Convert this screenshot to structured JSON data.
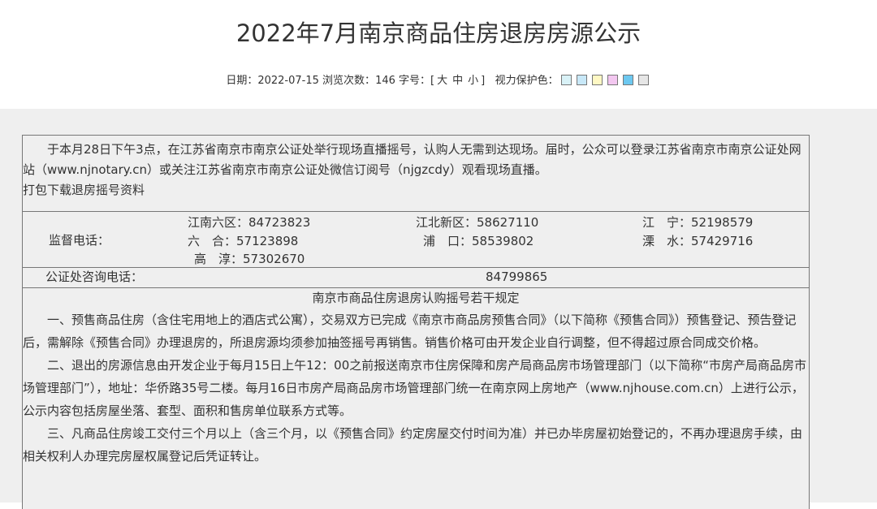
{
  "page": {
    "title": "2022年7月南京商品住房退房房源公示",
    "meta": {
      "date_label": "日期：",
      "date": "2022-07-15",
      "views_label": "浏览次数：",
      "views": "146",
      "fontsize_label": "字号：[",
      "font_large": "大",
      "font_medium": "中",
      "font_small": "小",
      "fontsize_close": "]",
      "eye_label": "视力保护色："
    },
    "eye_colors": [
      "#d9f2f7",
      "#c8e8f8",
      "#fff8c4",
      "#f3c7f0",
      "#6dc8f0",
      "#e6e6e6"
    ]
  },
  "notice": {
    "intro_text": "于本月28日下午3点，在江苏省南京市南京公证处举行现场直播摇号，认购人无需到达现场。届时，公众可以登录江苏省南京市南京公证处网站（www.njnotary.cn）或关注江苏省南京市南京公证处微信订阅号（njgzcdy）观看现场直播。",
    "download_link": "打包下载退房摇号资料"
  },
  "supervision": {
    "label": "监督电话：",
    "phones": [
      "江南六区：84723823",
      "江北新区：58627110",
      "江　宁：52198579",
      "六　合：57123898",
      "浦　口：58539802",
      "溧　水：57429716",
      "高　淳：57302670"
    ]
  },
  "consult": {
    "label": "公证处咨询电话：",
    "number": "84799865"
  },
  "rules": {
    "title": "南京市商品住房退房认购摇号若干规定",
    "paragraphs": [
      "一、预售商品住房（含住宅用地上的酒店式公寓），交易双方已完成《南京市商品房预售合同》（以下简称《预售合同》）预售登记、预告登记后，需解除《预售合同》办理退房的，所退房源均须参加抽签摇号再销售。销售价格可由开发企业自行调整，但不得超过原合同成交价格。",
      "二、退出的房源信息由开发企业于每月15日上午12：00之前报送南京市住房保障和房产局商品房市场管理部门（以下简称“市房产局商品房市场管理部门”），地址：华侨路35号二楼。每月16日市房产局商品房市场管理部门统一在南京网上房地产（www.njhouse.com.cn）上进行公示，公示内容包括房屋坐落、套型、面积和售房单位联系方式等。",
      "三、凡商品住房竣工交付三个月以上（含三个月，以《预售合同》约定房屋交付时间为准）并已办毕房屋初始登记的，不再办理退房手续，由相关权利人办理完房屋权属登记后凭证转让。"
    ]
  }
}
